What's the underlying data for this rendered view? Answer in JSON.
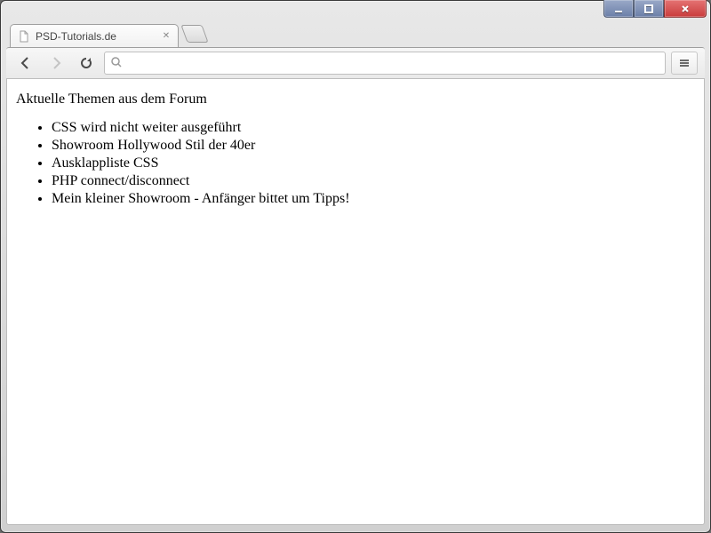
{
  "window": {
    "controls": {
      "minimize": "minimize",
      "maximize": "maximize",
      "close": "close"
    }
  },
  "tab": {
    "title": "PSD-Tutorials.de"
  },
  "toolbar": {
    "back": "Back",
    "forward": "Forward",
    "reload": "Reload",
    "menu": "Menu"
  },
  "omnibox": {
    "placeholder": "",
    "value": ""
  },
  "content": {
    "heading": "Aktuelle Themen aus dem Forum",
    "items": [
      "CSS wird nicht weiter ausgeführt",
      "Showroom Hollywood Stil der 40er",
      "Ausklappliste CSS",
      "PHP connect/disconnect",
      "Mein kleiner Showroom - Anfänger bittet um Tipps!"
    ]
  }
}
